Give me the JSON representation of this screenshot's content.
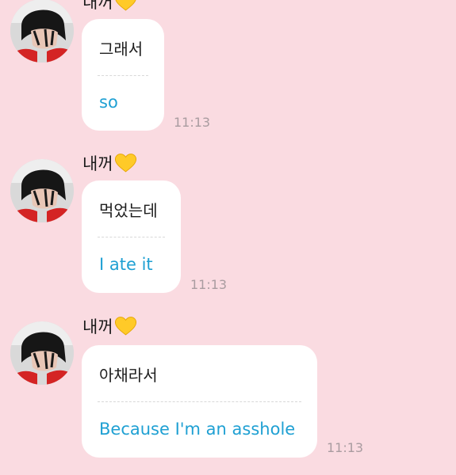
{
  "messages": [
    {
      "sender": "내꺼",
      "sender_icon": "yellow-heart-icon",
      "original": "그래서",
      "translation": "so",
      "time": "11:13"
    },
    {
      "sender": "내꺼",
      "sender_icon": "yellow-heart-icon",
      "original": "먹었는데",
      "translation": "I ate it",
      "time": "11:13"
    },
    {
      "sender": "내꺼",
      "sender_icon": "yellow-heart-icon",
      "original": "아채라서",
      "translation": "Because I'm an asshole",
      "time": "11:13"
    }
  ],
  "colors": {
    "background": "#fadbe1",
    "bubble": "#ffffff",
    "translation_text": "#1fa0d3",
    "timestamp": "#a99ca0",
    "heart": "#ffca28"
  }
}
